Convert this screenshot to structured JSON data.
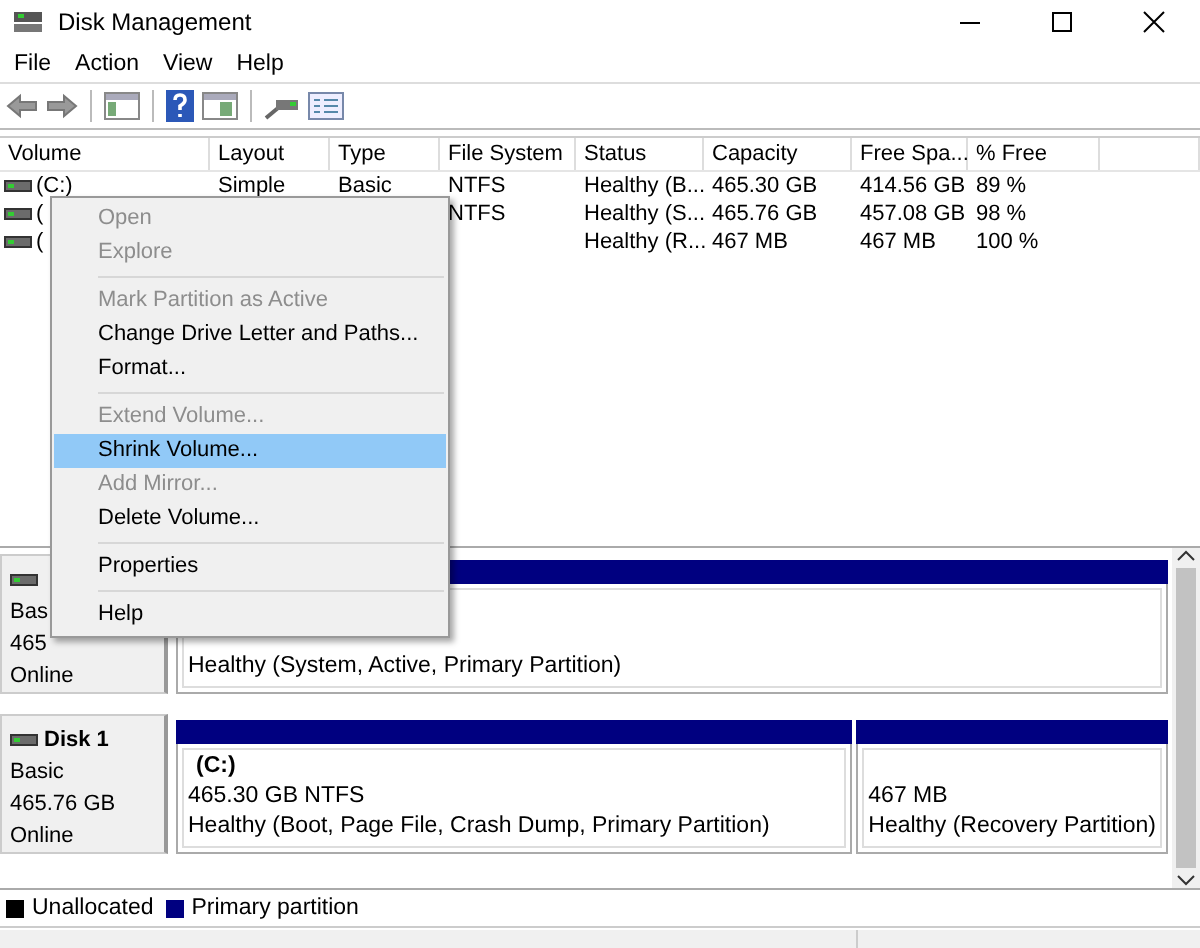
{
  "window": {
    "title": "Disk Management"
  },
  "menu_bar": [
    "File",
    "Action",
    "View",
    "Help"
  ],
  "volume_table": {
    "columns": [
      "Volume",
      "Layout",
      "Type",
      "File System",
      "Status",
      "Capacity",
      "Free Spa...",
      "% Free"
    ],
    "rows": [
      {
        "cells": [
          "(C:)",
          "Simple",
          "Basic",
          "NTFS",
          "Healthy (B...",
          "465.30 GB",
          "414.56 GB",
          "89 %"
        ]
      },
      {
        "cells": [
          "(",
          null,
          null,
          "NTFS",
          "Healthy (S...",
          "465.76 GB",
          "457.08 GB",
          "98 %"
        ]
      },
      {
        "cells": [
          "(",
          null,
          null,
          null,
          "Healthy (R...",
          "467 MB",
          "467 MB",
          "100 %"
        ]
      }
    ]
  },
  "disks": [
    {
      "type": "Bas",
      "size": "465",
      "status": "Online",
      "partitions": [
        {
          "status": "Healthy (System, Active, Primary Partition)"
        }
      ]
    },
    {
      "name": "Disk 1",
      "type": "Basic",
      "size": "465.76 GB",
      "status": "Online",
      "partitions": [
        {
          "name": "(C:)",
          "size": "465.30 GB NTFS",
          "status": "Healthy (Boot, Page File, Crash Dump, Primary Partition)"
        },
        {
          "size": "467 MB",
          "status": "Healthy (Recovery Partition)"
        }
      ]
    }
  ],
  "legend": [
    {
      "label": "Unallocated",
      "color": "#000000"
    },
    {
      "label": "Primary partition",
      "color": "#000080"
    }
  ],
  "context_menu": [
    {
      "kind": "item",
      "label": "Open",
      "disabled": true,
      "selected": false
    },
    {
      "kind": "item",
      "label": "Explore",
      "disabled": true,
      "selected": false
    },
    {
      "kind": "separator"
    },
    {
      "kind": "item",
      "label": "Mark Partition as Active",
      "disabled": true,
      "selected": false
    },
    {
      "kind": "item",
      "label": "Change Drive Letter and Paths...",
      "disabled": false,
      "selected": false
    },
    {
      "kind": "item",
      "label": "Format...",
      "disabled": false,
      "selected": false
    },
    {
      "kind": "separator"
    },
    {
      "kind": "item",
      "label": "Extend Volume...",
      "disabled": true,
      "selected": false
    },
    {
      "kind": "item",
      "label": "Shrink Volume...",
      "disabled": false,
      "selected": true
    },
    {
      "kind": "item",
      "label": "Add Mirror...",
      "disabled": true,
      "selected": false
    },
    {
      "kind": "item",
      "label": "Delete Volume...",
      "disabled": false,
      "selected": false
    },
    {
      "kind": "separator"
    },
    {
      "kind": "item",
      "label": "Properties",
      "disabled": false,
      "selected": false
    },
    {
      "kind": "separator"
    },
    {
      "kind": "item",
      "label": "Help",
      "disabled": false,
      "selected": false
    }
  ]
}
